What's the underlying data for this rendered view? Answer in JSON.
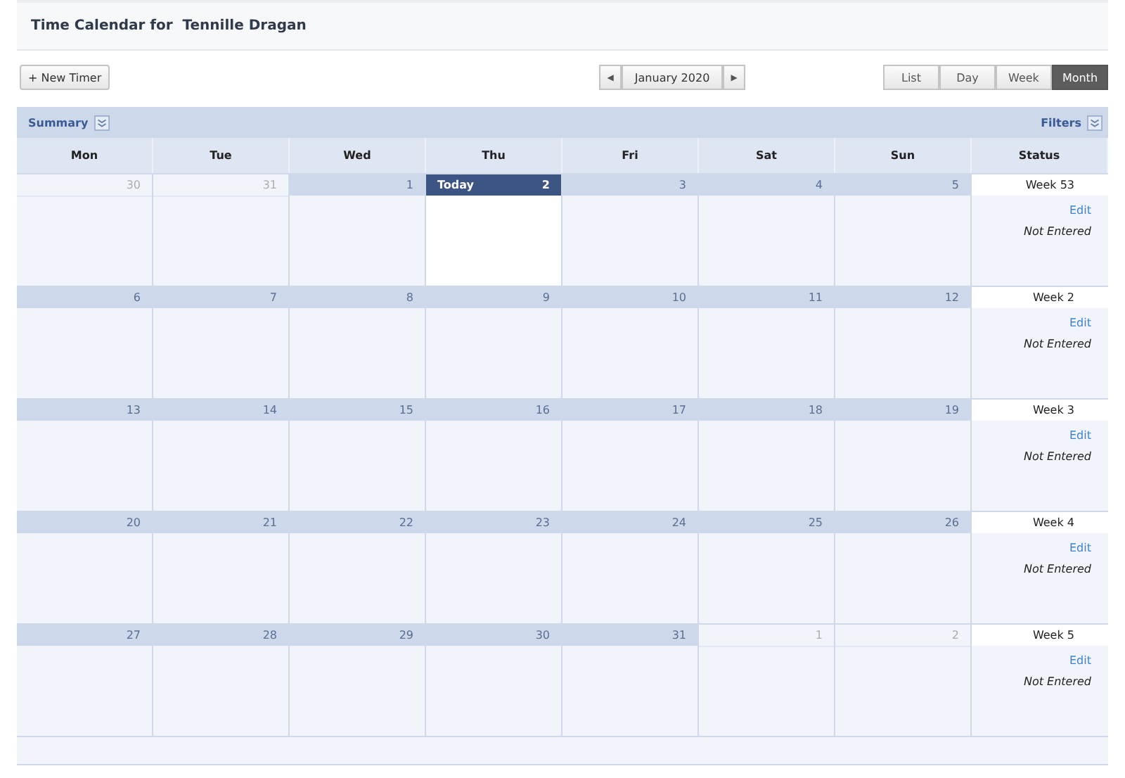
{
  "title": "Time Calendar for  Tennille Dragan",
  "new_timer": "+ New Timer",
  "prev": "◀",
  "month": "January 2020",
  "next": "▶",
  "views": [
    {
      "label": "List",
      "selected": false
    },
    {
      "label": "Day",
      "selected": false
    },
    {
      "label": "Week",
      "selected": false
    },
    {
      "label": "Month",
      "selected": true
    }
  ],
  "summary": "Summary",
  "filters": "Filters",
  "columns": [
    "Mon",
    "Tue",
    "Wed",
    "Thu",
    "Fri",
    "Sat",
    "Sun",
    "Status"
  ],
  "weeks": [
    {
      "days": [
        {
          "number": "30",
          "in_month": false,
          "today": false
        },
        {
          "number": "31",
          "in_month": false,
          "today": false
        },
        {
          "number": "1",
          "in_month": true,
          "today": false
        },
        {
          "number": "2",
          "today": true,
          "label": "Today"
        },
        {
          "number": "3",
          "in_month": true,
          "today": false
        },
        {
          "number": "4",
          "in_month": true,
          "today": false
        },
        {
          "number": "5",
          "in_month": true,
          "today": false
        }
      ],
      "week": "Week 53",
      "edit": "Edit",
      "status": "Not Entered"
    },
    {
      "days": [
        {
          "number": "6",
          "in_month": true,
          "today": false
        },
        {
          "number": "7",
          "in_month": true,
          "today": false
        },
        {
          "number": "8",
          "in_month": true,
          "today": false
        },
        {
          "number": "9",
          "in_month": true,
          "today": false
        },
        {
          "number": "10",
          "in_month": true,
          "today": false
        },
        {
          "number": "11",
          "in_month": true,
          "today": false
        },
        {
          "number": "12",
          "in_month": true,
          "today": false
        }
      ],
      "week": "Week 2",
      "edit": "Edit",
      "status": "Not Entered"
    },
    {
      "days": [
        {
          "number": "13",
          "in_month": true,
          "today": false
        },
        {
          "number": "14",
          "in_month": true,
          "today": false
        },
        {
          "number": "15",
          "in_month": true,
          "today": false
        },
        {
          "number": "16",
          "in_month": true,
          "today": false
        },
        {
          "number": "17",
          "in_month": true,
          "today": false
        },
        {
          "number": "18",
          "in_month": true,
          "today": false
        },
        {
          "number": "19",
          "in_month": true,
          "today": false
        }
      ],
      "week": "Week 3",
      "edit": "Edit",
      "status": "Not Entered"
    },
    {
      "days": [
        {
          "number": "20",
          "in_month": true,
          "today": false
        },
        {
          "number": "21",
          "in_month": true,
          "today": false
        },
        {
          "number": "22",
          "in_month": true,
          "today": false
        },
        {
          "number": "23",
          "in_month": true,
          "today": false
        },
        {
          "number": "24",
          "in_month": true,
          "today": false
        },
        {
          "number": "25",
          "in_month": true,
          "today": false
        },
        {
          "number": "26",
          "in_month": true,
          "today": false
        }
      ],
      "week": "Week 4",
      "edit": "Edit",
      "status": "Not Entered"
    },
    {
      "days": [
        {
          "number": "27",
          "in_month": true,
          "today": false
        },
        {
          "number": "28",
          "in_month": true,
          "today": false
        },
        {
          "number": "29",
          "in_month": true,
          "today": false
        },
        {
          "number": "30",
          "in_month": true,
          "today": false
        },
        {
          "number": "31",
          "in_month": true,
          "today": false
        },
        {
          "number": "1",
          "in_month": false,
          "today": false
        },
        {
          "number": "2",
          "in_month": false,
          "today": false
        }
      ],
      "week": "Week 5",
      "edit": "Edit",
      "status": "Not Entered"
    }
  ]
}
